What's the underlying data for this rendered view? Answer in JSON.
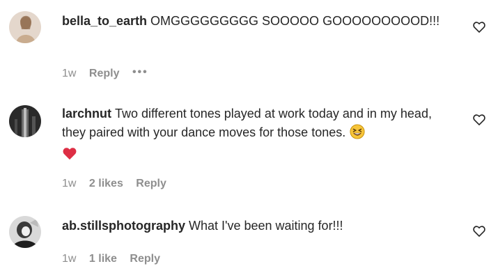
{
  "comments": [
    {
      "username": "bella_to_earth",
      "text": "OMGGGGGGGGG SOOOOO GOOOOOOOOOD!!!",
      "time": "1w",
      "likes": "",
      "reply_label": "Reply",
      "more_label": "•••",
      "avatar_icon": "user-avatar-beige"
    },
    {
      "username": "larchnut",
      "text": "Two different tones played at work today and in my head, they paired with your dance moves for those tones.",
      "emoji_icons": [
        "grinning-squinting-face-emoji",
        "red-heart-emoji"
      ],
      "time": "1w",
      "likes": "2 likes",
      "reply_label": "Reply",
      "avatar_icon": "user-avatar-dark"
    },
    {
      "username": "ab.stillsphotography",
      "text": "What I've been waiting for!!!",
      "time": "1w",
      "likes": "1 like",
      "reply_label": "Reply",
      "avatar_icon": "user-avatar-bw"
    }
  ],
  "colors": {
    "text": "#262626",
    "secondary": "#8e8e8e",
    "heart": "#e0245e"
  }
}
